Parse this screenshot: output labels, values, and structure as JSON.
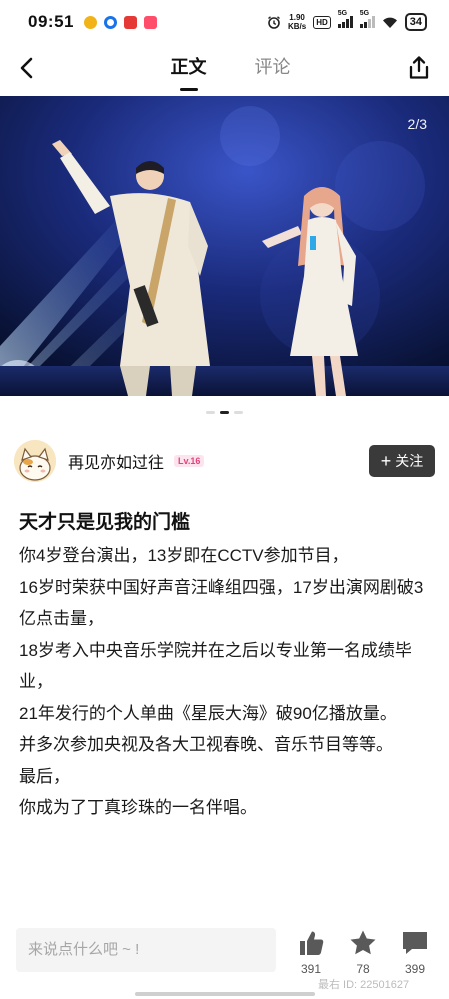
{
  "status_bar": {
    "time": "09:51",
    "net_speed_value": "1.90",
    "net_speed_unit": "KB/s",
    "hd_label": "HD",
    "signal1_label": "5G",
    "signal2_label": "5G",
    "battery": "34"
  },
  "nav": {
    "tab_main": "正文",
    "tab_comments": "评论"
  },
  "carousel": {
    "page_indicator": "2/3",
    "total_pages": 3,
    "current_page": 2
  },
  "author": {
    "name": "再见亦如过往",
    "level": "Lv.16",
    "follow_label": "关注",
    "follow_plus": "+"
  },
  "article": {
    "title": "天才只是见我的门槛",
    "lines": [
      "你4岁登台演出，13岁即在CCTV参加节目，",
      "16岁时荣获中国好声音汪峰组四强，17岁出演网剧破3亿点击量，",
      "18岁考入中央音乐学院并在之后以专业第一名成绩毕业，",
      "21年发行的个人单曲《星辰大海》破90亿播放量。",
      "并多次参加央视及各大卫视春晚、音乐节目等等。",
      "最后，",
      "你成为了丁真珍珠的一名伴唱。"
    ]
  },
  "bottom_bar": {
    "comment_placeholder": "来说点什么吧 ~ !",
    "likes": "391",
    "favorites": "78",
    "comments": "399",
    "watermark": "最右  ID: 22501627"
  },
  "icons": {
    "back": "back-arrow-icon",
    "share": "share-icon",
    "like": "thumbs-up-icon",
    "favorite": "star-icon",
    "comment": "comment-bubble-icon"
  },
  "colors": {
    "follow_button": "#3a3a3a",
    "level_badge_text": "#e0457b",
    "level_badge_bg": "#fde3ee",
    "icon_gray": "#595959",
    "stage_background": "#0d1a4a"
  }
}
